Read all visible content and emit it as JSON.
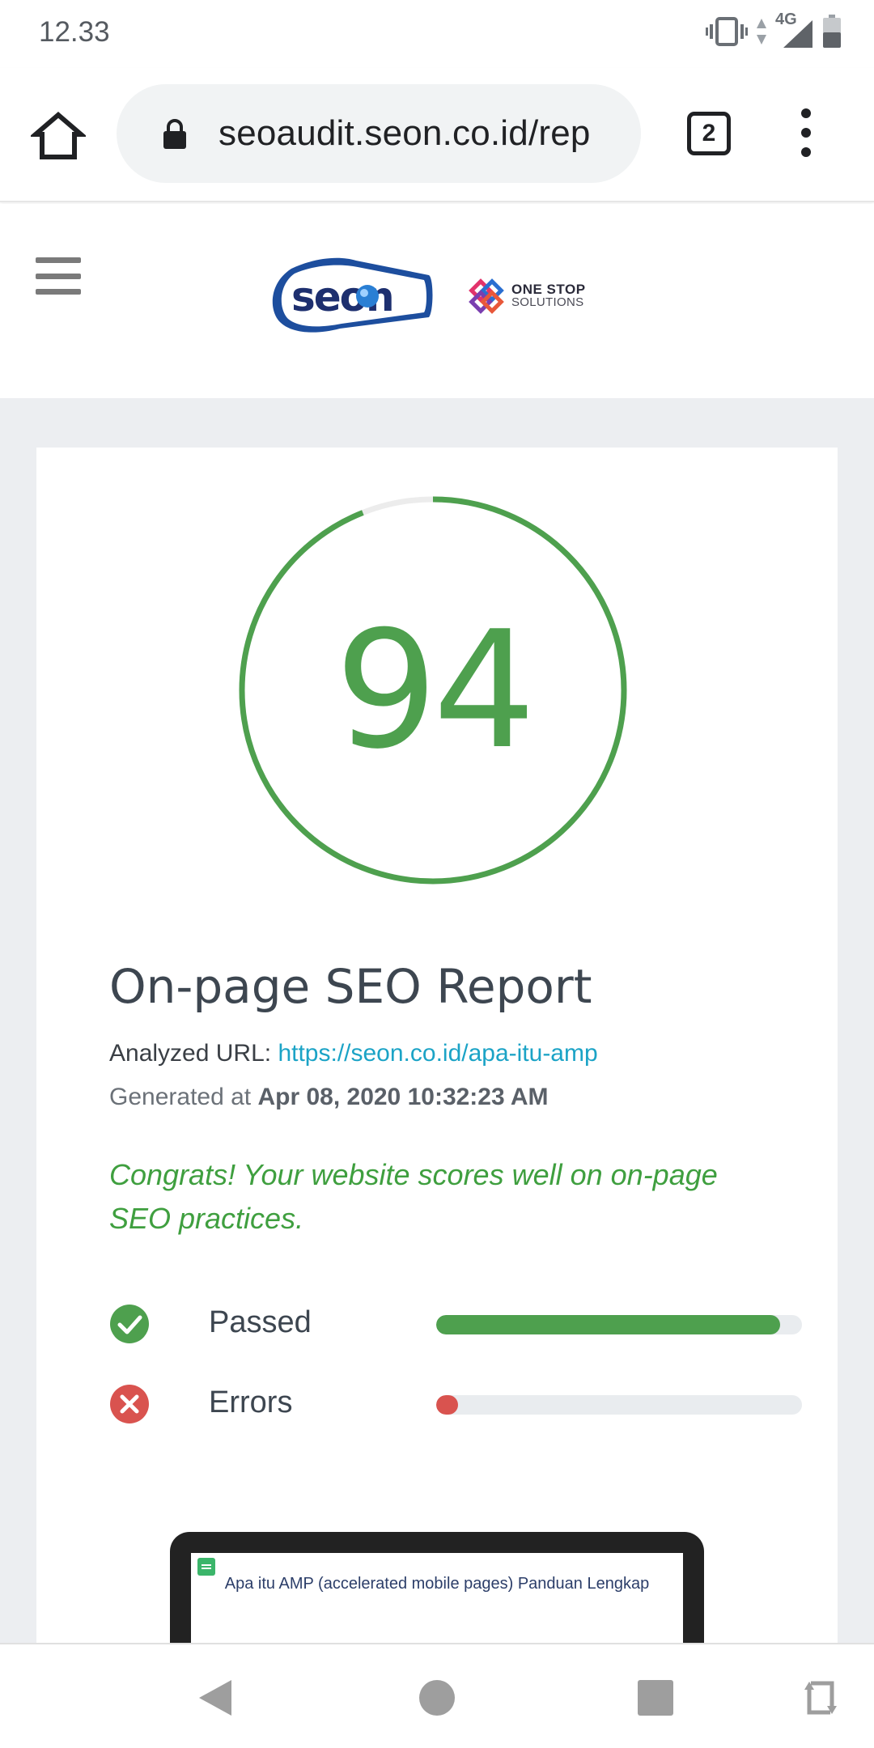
{
  "status_bar": {
    "time": "12.33",
    "network": "4G"
  },
  "browser": {
    "url": "seoaudit.seon.co.id/rep",
    "tab_count": "2"
  },
  "header": {
    "brand_logo": "seon",
    "partner_line1": "ONE STOP",
    "partner_line2": "SOLUTIONS"
  },
  "report": {
    "score": "94",
    "score_value": 94,
    "title": "On-page SEO Report",
    "analyzed_label": "Analyzed URL:",
    "analyzed_url": "https://seon.co.id/apa-itu-amp",
    "generated_label": "Generated at",
    "generated_date": "Apr 08, 2020 10:32:23 AM",
    "congrats": "Congrats! Your website scores well on on-page SEO practices.",
    "metrics": [
      {
        "label": "Passed",
        "fraction": 0.94,
        "color": "#4ea04e",
        "icon": "check-circle-icon"
      },
      {
        "label": "Errors",
        "fraction": 0.06,
        "color": "#d9534f",
        "icon": "x-circle-icon"
      }
    ],
    "preview_title": "Apa itu AMP (accelerated mobile pages) Panduan Lengkap"
  },
  "colors": {
    "score_green": "#4ea04e",
    "ring_track": "#ececec",
    "link": "#1ba3c6",
    "error_red": "#d9534f",
    "page_gray": "#eceef1"
  }
}
